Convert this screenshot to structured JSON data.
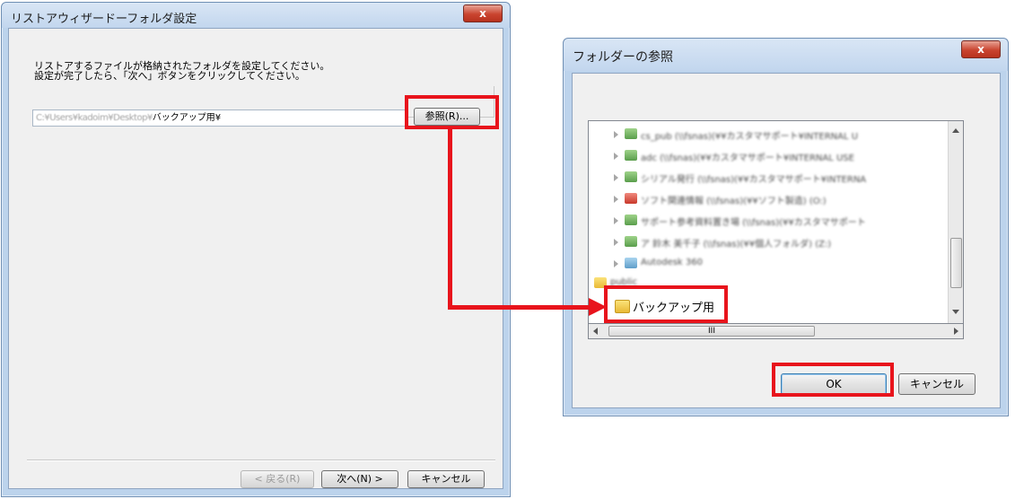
{
  "wizard": {
    "title": "リストアウィザードーフォルダ設定",
    "close_label": "x",
    "instruction_line1": "リストアするファイルが格納されたフォルダを設定してください。",
    "instruction_line2": "設定が完了したら、「次へ」ボタンをクリックしてください。",
    "path_prefix": "C:¥Users¥kadoim¥Desktop¥",
    "path_suffix": "バックアップ用¥",
    "browse_button": "参照(R)...",
    "back_button": "< 戻る(R)",
    "next_button": "次へ(N) >",
    "cancel_button": "キャンセル"
  },
  "browse_dialog": {
    "title": "フォルダーの参照",
    "close_label": "x",
    "tree_items": [
      {
        "label": "cs_pub (\\\\fsnas)(¥¥カスタマサポート¥INTERNAL U",
        "icon": "network-drive-icon"
      },
      {
        "label": "adc (\\\\fsnas)(¥¥カスタマサポート¥INTERNAL USE",
        "icon": "network-drive-icon"
      },
      {
        "label": "シリアル発行 (\\\\fsnas)(¥¥カスタマサポート¥INTERNA",
        "icon": "network-drive-icon"
      },
      {
        "label": "ソフト関連情報 (\\\\fsnas)(¥¥ソフト製造) (O:)",
        "icon": "network-drive-error-icon"
      },
      {
        "label": "サポート参考資料置き場 (\\\\fsnas)(¥¥カスタマサポート",
        "icon": "network-drive-icon"
      },
      {
        "label": "ア 鈴木 美千子 (\\\\fsnas)(¥¥個人フォルダ) (Z:)",
        "icon": "network-drive-icon"
      },
      {
        "label": "Autodesk 360",
        "icon": "cloud-icon"
      },
      {
        "label": "public",
        "icon": "folder-icon"
      }
    ],
    "selected_folder": "バックアップ用",
    "hscroll_grip": "III",
    "ok_button": "OK",
    "cancel_button": "キャンセル"
  },
  "colors": {
    "highlight_red": "#e8141c",
    "folder_yellow": "#f2c94c",
    "close_red": "#c9442f"
  }
}
